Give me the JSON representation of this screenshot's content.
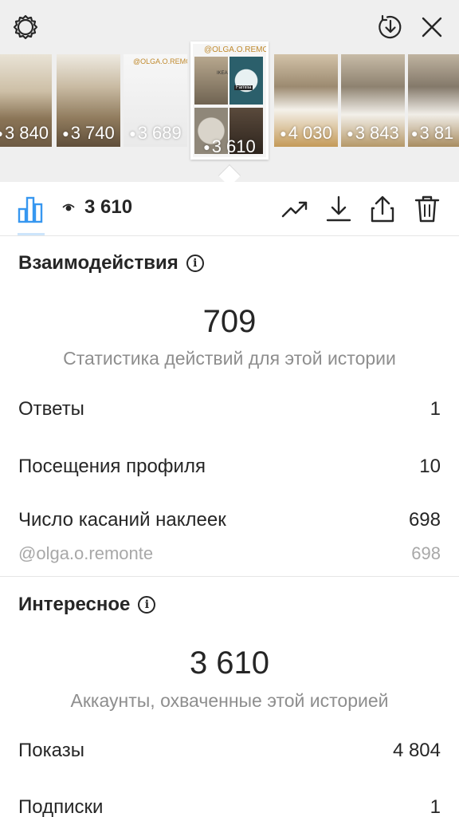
{
  "thumbnails": [
    {
      "views": "3 840",
      "color": "#b9a994"
    },
    {
      "views": "3 740",
      "color": "#a4957c"
    },
    {
      "views": "3 689",
      "color": "#f2f2f2",
      "label": "@OLGA.O.REMONTE"
    },
    {
      "views": "3 610",
      "selected": true,
      "label": "@OLGA.O.REMONTE",
      "sublabels": [
        "IKEA",
        "Familia"
      ]
    },
    {
      "views": "4 030",
      "color": "#b8a58c"
    },
    {
      "views": "3 843",
      "color": "#a99c88"
    },
    {
      "views": "3 81",
      "color": "#9d907c"
    }
  ],
  "toolbar": {
    "views": "3 610",
    "accent_color": "#3797f0",
    "icons": [
      "bar-chart-icon",
      "eye-icon",
      "trend-up-icon",
      "download-icon",
      "share-icon",
      "trash-icon"
    ]
  },
  "interactions": {
    "title": "Взаимодействия",
    "total": "709",
    "caption": "Статистика действий для этой истории",
    "rows": [
      {
        "label": "Ответы",
        "value": "1"
      },
      {
        "label": "Посещения профиля",
        "value": "10"
      },
      {
        "label": "Число касаний наклеек",
        "value": "698"
      }
    ],
    "sticker": {
      "label": "@olga.o.remonte",
      "value": "698"
    }
  },
  "discovery": {
    "title": "Интересное",
    "total": "3 610",
    "caption": "Аккаунты, охваченные этой историей",
    "rows": [
      {
        "label": "Показы",
        "value": "4 804"
      },
      {
        "label": "Подписки",
        "value": "1"
      }
    ]
  }
}
